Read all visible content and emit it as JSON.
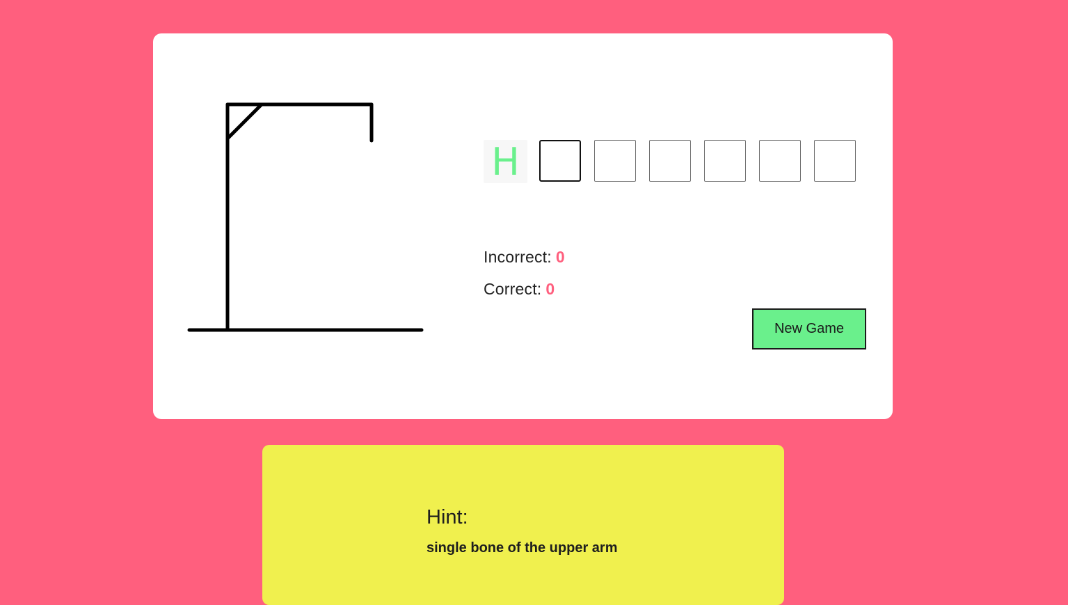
{
  "game": {
    "letters": [
      "H",
      "",
      "",
      "",
      "",
      "",
      ""
    ],
    "active_index": 1,
    "incorrect_label": "Incorrect:",
    "incorrect_count": "0",
    "correct_label": "Correct:",
    "correct_count": "0",
    "new_game_label": "New Game"
  },
  "hint": {
    "title": "Hint:",
    "text": "single bone of the upper arm"
  },
  "colors": {
    "background": "#ff5f7e",
    "accent_green": "#6af08c",
    "hint_yellow": "#f0f04e",
    "count_pink": "#ff5f7e"
  }
}
